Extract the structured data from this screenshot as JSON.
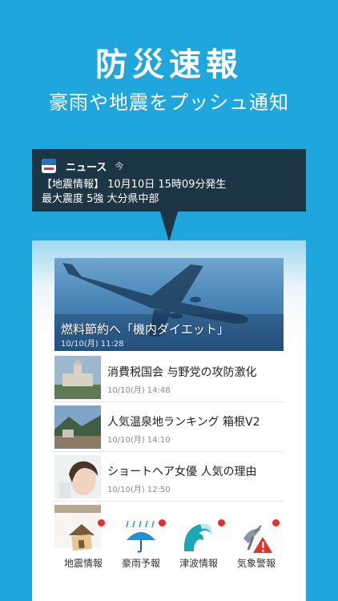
{
  "header": {
    "title": "防災速報",
    "subtitle": "豪雨や地震をプッシュ通知"
  },
  "notification": {
    "app_name": "ニュース",
    "time": "今",
    "line1": "【地震情報】 10月10日 15時09分発生",
    "line2": "最大震度 5強 大分県中部"
  },
  "news": {
    "hero": {
      "title": "燃料節約へ「機内ダイエット」",
      "date": "10/10(月) 11:28"
    },
    "items": [
      {
        "title": "消費税国会 与野党の攻防激化",
        "date": "10/10(月) 14:48"
      },
      {
        "title": "人気温泉地ランキング 箱根V2",
        "date": "10/10(月) 14:10"
      },
      {
        "title": "ショートヘア女優 人気の理由",
        "date": "10/10(月) 12:50"
      }
    ]
  },
  "tabs": [
    {
      "label": "地震情報",
      "icon": "house-icon"
    },
    {
      "label": "豪雨予報",
      "icon": "umbrella-icon"
    },
    {
      "label": "津波情報",
      "icon": "wave-icon"
    },
    {
      "label": "気象警報",
      "icon": "radar-warning-icon"
    }
  ],
  "colors": {
    "background": "#1fa6dc",
    "notification_bg": "#1d3646",
    "badge": "#e0312c"
  }
}
